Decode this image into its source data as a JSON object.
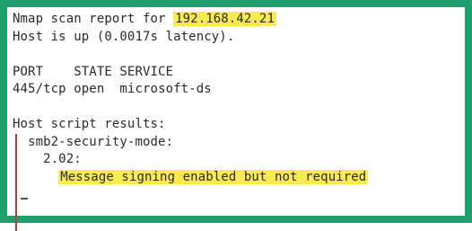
{
  "report_line": "Nmap scan report for ",
  "ip_address": "192.168.42.21",
  "host_status": "Host is up (0.0017s latency).",
  "ports_header": "PORT    STATE SERVICE",
  "port_row": {
    "port": "445/tcp",
    "state": "open",
    "service": "microsoft-ds"
  },
  "script_results_header": "Host script results:",
  "script_name": "smb2-security-mode:",
  "smb_version": "2.02:",
  "signing_message": "Message signing enabled but not required",
  "colors": {
    "frame": "#1f9e6e",
    "highlight": "#fbea4f",
    "tree_marker": "#c0392b"
  }
}
